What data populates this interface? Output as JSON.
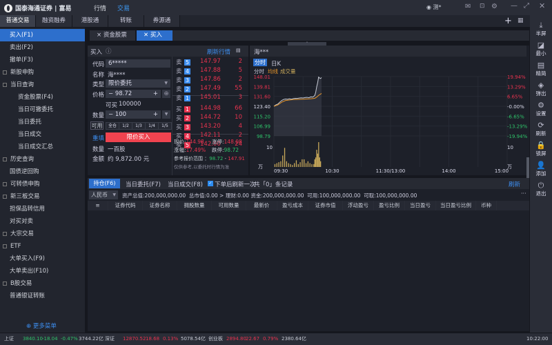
{
  "header": {
    "logo_text": "国泰海通证券 | 富易",
    "nav": [
      "行情",
      "交易"
    ],
    "active_nav": "交易",
    "user": "测*"
  },
  "main_tabs": [
    "普通交易",
    "融资融券",
    "港股通",
    "转账",
    "券源通"
  ],
  "sidebar": {
    "items": [
      {
        "label": "买入(F1)",
        "active": true
      },
      {
        "label": "卖出(F2)"
      },
      {
        "label": "撤单(F3)"
      },
      {
        "label": "新股申购",
        "expand": true
      },
      {
        "label": "当日查询",
        "expand": true
      },
      {
        "label": "资金股票(F4)",
        "sub": true
      },
      {
        "label": "当日可撤委托",
        "sub": true
      },
      {
        "label": "当日委托",
        "sub": true
      },
      {
        "label": "当日成交",
        "sub": true
      },
      {
        "label": "当日成交汇总",
        "sub": true
      },
      {
        "label": "历史查询",
        "expand": true
      },
      {
        "label": "国债逆回购"
      },
      {
        "label": "可转债申购",
        "expand": true
      },
      {
        "label": "新三板交易",
        "expand": true
      },
      {
        "label": "担保品转信用"
      },
      {
        "label": "对买对卖"
      },
      {
        "label": "大宗交易",
        "expand": true
      },
      {
        "label": "ETF",
        "expand": true
      },
      {
        "label": "大单买入(F9)"
      },
      {
        "label": "大单卖出(F10)"
      },
      {
        "label": "B股交易",
        "expand": true
      },
      {
        "label": "普通银证转账"
      }
    ],
    "more": "更多菜单"
  },
  "content_tabs": [
    {
      "label": "资金股票"
    },
    {
      "label": "买入",
      "active": true
    }
  ],
  "order": {
    "title": "买入",
    "refresh": "刷新行情",
    "code_label": "代码",
    "code": "6*****",
    "name_label": "名称",
    "name": "海****",
    "type_label": "类型",
    "type": "限价委托",
    "price_label": "价格",
    "price": "98.72",
    "buyable_label": "可买",
    "buyable": "100000",
    "qty_label": "数量",
    "qty": "100",
    "avail_label": "可用",
    "fractions": [
      "全仓",
      "1/2",
      "1/3",
      "1/4",
      "1/5"
    ],
    "reset": "重填",
    "submit": "限价买入",
    "qty_text_label": "数量",
    "qty_text": "一百股",
    "amount_label": "金额",
    "amount": "约 9,872.00 元"
  },
  "orderbook": {
    "asks": [
      {
        "l": "卖",
        "n": "5",
        "p": "147.97",
        "v": "2"
      },
      {
        "l": "卖",
        "n": "4",
        "p": "147.88",
        "v": "5"
      },
      {
        "l": "卖",
        "n": "3",
        "p": "147.86",
        "v": "2"
      },
      {
        "l": "卖",
        "n": "2",
        "p": "147.49",
        "v": "55"
      },
      {
        "l": "卖",
        "n": "1",
        "p": "145.01",
        "v": "3"
      }
    ],
    "bids": [
      {
        "l": "买",
        "n": "1",
        "p": "144.98",
        "v": "66"
      },
      {
        "l": "买",
        "n": "2",
        "p": "144.72",
        "v": "10"
      },
      {
        "l": "买",
        "n": "3",
        "p": "143.20",
        "v": "4"
      },
      {
        "l": "买",
        "n": "4",
        "p": "142.11",
        "v": "2"
      },
      {
        "l": "买",
        "n": "5",
        "p": "142.00",
        "v": "24"
      }
    ],
    "last_label": "现价:",
    "last": "144.98",
    "limit_up_label": "涨停:",
    "limit_up": "148.08",
    "change_label": "涨幅:",
    "change": "17.49%",
    "limit_down_label": "跌停:",
    "limit_down": "98.72",
    "range_label": "参考报价范围",
    "range_low": "98.72",
    "range_sep": "-",
    "range_high": "147.91",
    "note": "仅供参考,以委托时行情为准"
  },
  "chart_panel": {
    "title": "海***",
    "tabs": [
      "分时",
      "日K"
    ],
    "legend": [
      "分时",
      "均线",
      "成交量"
    ]
  },
  "chart_data": {
    "type": "line",
    "title": "海***",
    "x_labels": [
      "09:30",
      "10:30",
      "11:30/13:00",
      "14:00",
      "15:00"
    ],
    "y_left": [
      "148.01",
      "139.81",
      "131.60",
      "123.40",
      "115.20",
      "106.99",
      "98.79"
    ],
    "y_right": [
      "19.94%",
      "13.29%",
      "6.65%",
      "-0.00%",
      "-6.65%",
      "-13.29%",
      "-19.94%"
    ],
    "ylim": [
      98.79,
      148.01
    ],
    "xlim_minutes": [
      0,
      240
    ],
    "vol_labels": [
      "10",
      "万"
    ],
    "vol_max": 13,
    "series": [
      {
        "name": "分时",
        "color": "#c8ccd6",
        "x": [
          0,
          2,
          4,
          6,
          8,
          10,
          12,
          14,
          16,
          18,
          20,
          22,
          24,
          26,
          28,
          30,
          32,
          34,
          36,
          38,
          40,
          42,
          43,
          44,
          45,
          46,
          47,
          48,
          49
        ],
        "y": [
          123.4,
          124.6,
          125.2,
          126.8,
          128.2,
          129.1,
          129.4,
          129.2,
          129.6,
          129.3,
          129.8,
          130.0,
          129.9,
          130.2,
          130.4,
          130.3,
          130.6,
          130.8,
          130.5,
          131.2,
          131.0,
          132.3,
          135,
          139.5,
          143,
          147.6,
          146.8,
          146.4,
          147.2
        ]
      },
      {
        "name": "均线",
        "color": "#e8962a",
        "x": [
          0,
          4,
          8,
          12,
          20,
          30,
          38,
          42,
          44,
          46,
          49
        ],
        "y": [
          123.4,
          124.5,
          126.8,
          128.2,
          129,
          129.3,
          129.6,
          130,
          131,
          132.5,
          134
        ]
      }
    ],
    "volume": {
      "x": [
        1,
        3,
        5,
        7,
        9,
        11,
        13,
        15,
        17,
        19,
        21,
        23,
        25,
        27,
        29,
        31,
        33,
        35,
        37,
        39,
        41,
        42,
        43,
        44,
        45,
        46,
        47,
        48
      ],
      "y": [
        1.5,
        2,
        2.5,
        3,
        6,
        10,
        3,
        2,
        1.5,
        1,
        2,
        3.5,
        1.5,
        2.5,
        4,
        4,
        2,
        3,
        2,
        1.5,
        1.5,
        4,
        5,
        9,
        7,
        13,
        5,
        3
      ]
    }
  },
  "positions": {
    "tabs": [
      "持仓(F6)",
      "当日委托(F7)",
      "当日成交(F8)"
    ],
    "refresh_after": "下单后刷新一次",
    "records": "共「0」条记录",
    "refresh": "刷新",
    "currency": "人民币",
    "summary": "资产总值:200,000,000.00  总市值:0.00 > 理财:0.00 资金:200,000,000.00  可用:100,000,000.00  可取:100,000,000.00",
    "columns": [
      "证券代码",
      "证券名称",
      "拥股数量",
      "可用数量",
      "最新价",
      "盈亏成本",
      "证券市值",
      "浮动盈亏",
      "盈亏比例",
      "当日盈亏",
      "当日盈亏比例",
      "币种"
    ]
  },
  "right_toolbar": [
    {
      "label": "半屏",
      "icon": "⤓"
    },
    {
      "label": "最小",
      "icon": "◪"
    },
    {
      "label": "精简",
      "icon": "▤"
    },
    {
      "label": "弹出",
      "icon": "◈"
    },
    {
      "label": "设置",
      "icon": "⚙"
    },
    {
      "label": "刷新",
      "icon": "⟳"
    },
    {
      "label": "锁屏",
      "icon": "🔒"
    },
    {
      "label": "添加",
      "icon": "👤"
    },
    {
      "label": "退出",
      "icon": "⏻"
    }
  ],
  "status_bar": {
    "sh_label": "上证",
    "sh": "3840.10",
    "sh_chg": "-18.04",
    "sh_pct": "-0.47%",
    "sh_amt": "3744.22亿",
    "sz_label": "深证",
    "sz": "12870.52",
    "sz_chg": "18.68",
    "sz_pct": "0.13%",
    "sz_amt": "5078.54亿",
    "cy_label": "创业板",
    "cy": "2894.80",
    "cy_chg": "22.67",
    "cy_pct": "0.79%",
    "cy_amt": "2380.64亿",
    "time": "10:22:00"
  },
  "colors": {
    "accent": "#2d6fcc",
    "up": "#e8334f",
    "down": "#2fc36a",
    "avg": "#e8962a",
    "volume": "#c9a95a"
  }
}
